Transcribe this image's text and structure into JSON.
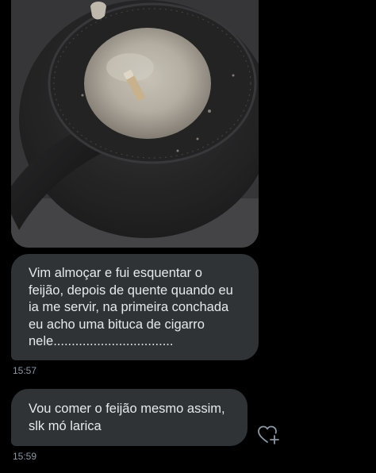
{
  "messages": [
    {
      "type": "image",
      "alt": ""
    },
    {
      "type": "text",
      "text": "Vim almoçar e fui esquentar o\nfeijão, depois de quente quando eu\nia me servir, na primeira conchada\neu acho uma bituca de cigarro\nnele.................................",
      "time": "15:57"
    },
    {
      "type": "text",
      "text": "Vou comer o feijão mesmo assim,\nslk mó larica",
      "time": "15:59"
    }
  ],
  "icons": {
    "react": "heart-plus-icon"
  },
  "colors": {
    "background": "#000000",
    "bubble": "#2f3336",
    "text": "#e7e9ea",
    "timestamp": "#8b98a5"
  }
}
